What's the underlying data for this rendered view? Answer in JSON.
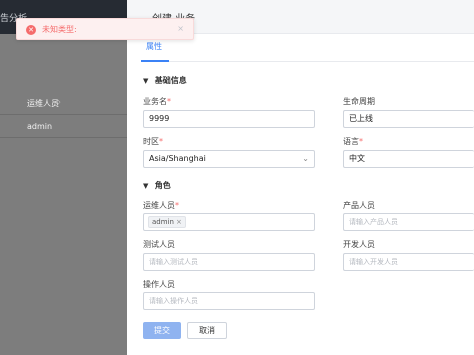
{
  "background": {
    "title": "告分析",
    "column_header": "运维人员",
    "sort_glyph": "◇",
    "cell": "admin"
  },
  "toast": {
    "icon": "error-circle-icon",
    "text": "未知类型:",
    "close": "×"
  },
  "drawer": {
    "title": "创建 业务",
    "tab": "属性",
    "sections": {
      "basic": "基础信息",
      "role": "角色"
    },
    "fields": {
      "business_name": {
        "label": "业务名",
        "value": "9999"
      },
      "lifecycle": {
        "label": "生命周期",
        "value": "已上线"
      },
      "timezone": {
        "label": "时区",
        "value": "Asia/Shanghai"
      },
      "language": {
        "label": "语言",
        "value": "中文"
      },
      "ops": {
        "label": "运维人员",
        "tag": "admin"
      },
      "product": {
        "label": "产品人员",
        "placeholder": "请输入产品人员"
      },
      "test": {
        "label": "测试人员",
        "placeholder": "请输入测试人员"
      },
      "dev": {
        "label": "开发人员",
        "placeholder": "请输入开发人员"
      },
      "operator": {
        "label": "操作人员",
        "placeholder": "请输入操作人员"
      }
    },
    "required_mark": "*",
    "buttons": {
      "submit": "提交",
      "cancel": "取消"
    }
  },
  "colors": {
    "accent": "#3b82f6",
    "error": "#f56c6c",
    "overlay": "#7d7d7d"
  }
}
